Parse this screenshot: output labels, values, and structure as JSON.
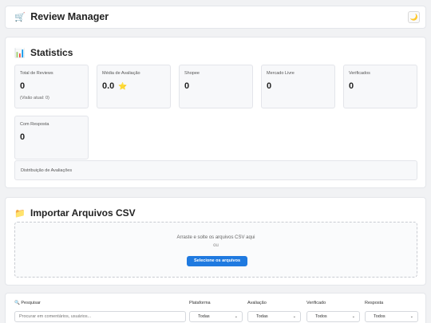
{
  "header": {
    "title_icon": "🛒",
    "title": "Review Manager",
    "theme_icon": "🌙"
  },
  "statistics": {
    "icon": "📊",
    "title": "Statistics",
    "cards": [
      {
        "label": "Total de Reviews",
        "value": "0",
        "sub": "(Visão atual: 0)"
      },
      {
        "label": "Média de Avaliação",
        "value": "0.0",
        "star": "⭐"
      },
      {
        "label": "Shopee",
        "value": "0"
      },
      {
        "label": "Mercado Livre",
        "value": "0"
      },
      {
        "label": "Verificados",
        "value": "0"
      },
      {
        "label": "Com Resposta",
        "value": "0"
      }
    ],
    "distribution_label": "Distribuição de Avaliações"
  },
  "import": {
    "icon": "📁",
    "title": "Importar Arquivos CSV",
    "drop_message": "Arraste e solte os arquivos CSV aqui",
    "or": "ou",
    "select_button": "Selecione os arquivos"
  },
  "filters": {
    "search_icon": "🔍",
    "search_label": "Pesquisar",
    "search_placeholder": "Procurar em comentários, usuários...",
    "platform_label": "Plataforma",
    "platform_value": "Todas",
    "rating_label": "Avaliação",
    "rating_value": "Todas",
    "verified_label": "Verificado",
    "verified_value": "Todos",
    "response_label": "Resposta",
    "response_value": "Todos"
  },
  "icons": {
    "chevron": "chevron-down-icon"
  }
}
